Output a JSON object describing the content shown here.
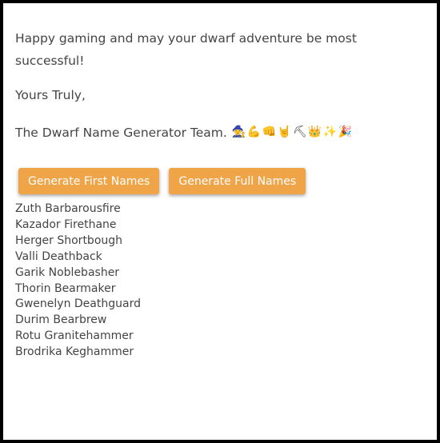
{
  "message": {
    "happy": "Happy gaming and may your dwarf adventure be most successful!",
    "yours": "Yours Truly,",
    "signature": "The Dwarf Name Generator Team."
  },
  "emojis": [
    {
      "char": "🧙",
      "name": "wizard-emoji"
    },
    {
      "char": "💪",
      "name": "flexed-biceps-emoji"
    },
    {
      "char": "👊",
      "name": "fist-emoji"
    },
    {
      "char": "🤘",
      "name": "rock-hand-emoji"
    },
    {
      "char": "⛏",
      "name": "pick-emoji"
    },
    {
      "char": "👑",
      "name": "crown-emoji"
    },
    {
      "char": "✨",
      "name": "sparkles-emoji"
    },
    {
      "char": "🎉",
      "name": "party-popper-emoji"
    }
  ],
  "buttons": {
    "first_names": "Generate First Names",
    "full_names": "Generate Full Names"
  },
  "names": [
    "Zuth Barbarousfire",
    "Kazador Firethane",
    "Herger Shortbough",
    "Valli Deathback",
    "Garik Noblebasher",
    "Thorin Bearmaker",
    "Gwenelyn Deathguard",
    "Durim Bearbrew",
    "Rotu Granitehammer",
    "Brodrika Keghammer"
  ],
  "colors": {
    "button_bg": "#f0a448",
    "text": "#444444",
    "border": "#000000"
  }
}
